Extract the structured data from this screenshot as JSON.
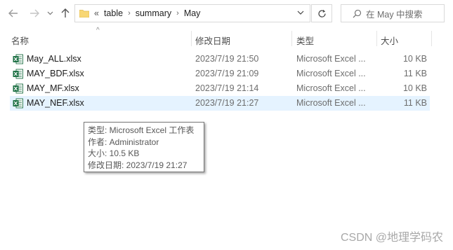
{
  "address_bar": {
    "overflow": "«",
    "crumbs": [
      "table",
      "summary",
      "May"
    ]
  },
  "search": {
    "placeholder": "在 May 中搜索"
  },
  "columns": {
    "name": "名称",
    "date": "修改日期",
    "type": "类型",
    "size": "大小"
  },
  "files": [
    {
      "name": "May_ALL.xlsx",
      "date": "2023/7/19 21:50",
      "type": "Microsoft Excel ...",
      "size": "10 KB"
    },
    {
      "name": "MAY_BDF.xlsx",
      "date": "2023/7/19 21:09",
      "type": "Microsoft Excel ...",
      "size": "11 KB"
    },
    {
      "name": "MAY_MF.xlsx",
      "date": "2023/7/19 21:14",
      "type": "Microsoft Excel ...",
      "size": "10 KB"
    },
    {
      "name": "MAY_NEF.xlsx",
      "date": "2023/7/19 21:27",
      "type": "Microsoft Excel ...",
      "size": "11 KB"
    }
  ],
  "tooltip": {
    "type": "类型: Microsoft Excel 工作表",
    "author": "作者: Administrator",
    "size": "大小: 10.5 KB",
    "modified": "修改日期: 2023/7/19 21:27"
  },
  "watermark": "CSDN @地理学码农",
  "colors": {
    "selection": "#e5f3ff",
    "excel_green": "#1e7145",
    "folder_yellow": "#f8d775"
  },
  "icons": [
    "back-arrow-icon",
    "forward-arrow-icon",
    "recent-chevron-icon",
    "up-arrow-icon",
    "folder-icon",
    "chevron-down-icon",
    "refresh-icon",
    "search-icon",
    "excel-file-icon"
  ]
}
